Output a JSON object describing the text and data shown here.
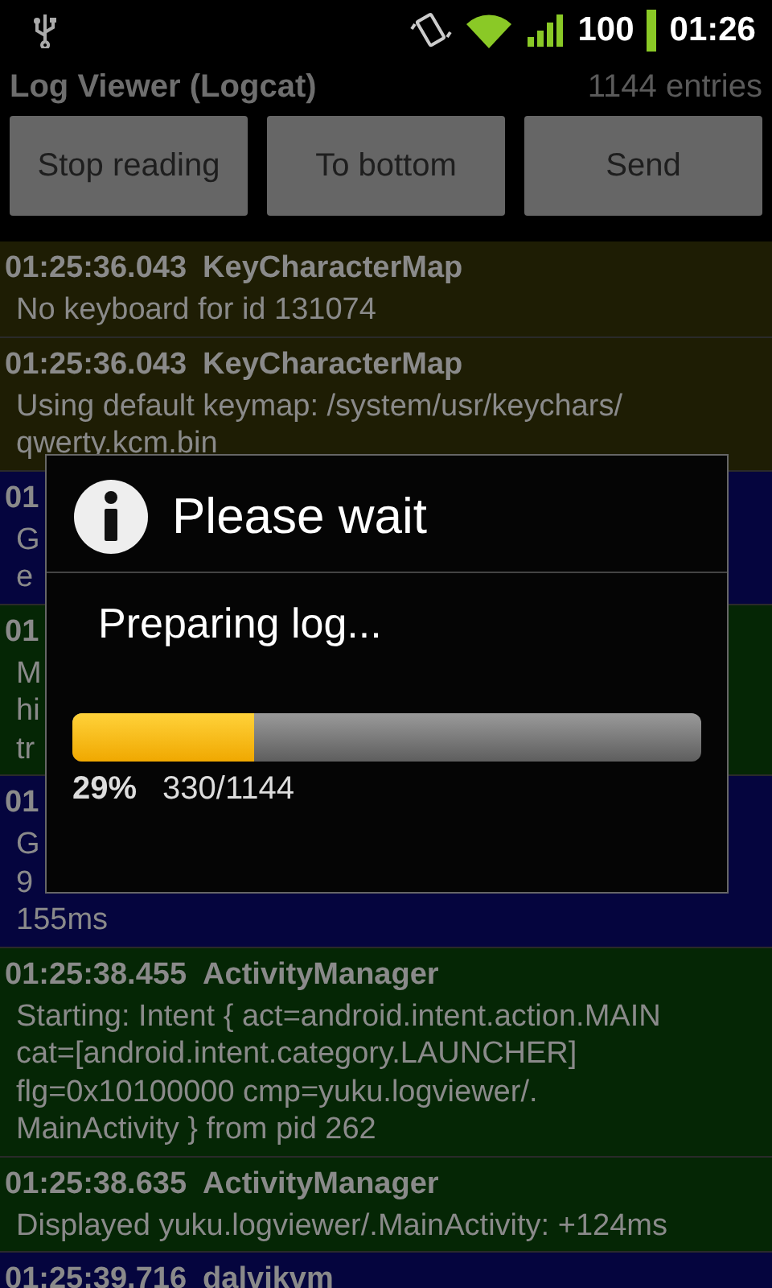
{
  "status_bar": {
    "battery": "100",
    "time": "01:26"
  },
  "header": {
    "title": "Log Viewer (Logcat)",
    "count": "1144 entries"
  },
  "buttons": [
    "Stop reading",
    "To bottom",
    "Send"
  ],
  "log_entries": [
    {
      "time": "01:25:36.043",
      "tag": "KeyCharacterMap",
      "message": "No keyboard for id 131074",
      "color": "#1e1d04"
    },
    {
      "time": "01:25:36.043",
      "tag": "KeyCharacterMap",
      "message": "Using default keymap: /system/usr/keychars/ qwerty.kcm.bin",
      "color": "#1e1d04"
    },
    {
      "time": "01",
      "lines": [
        "G",
        "e"
      ],
      "color": "#05053e"
    },
    {
      "time": "01",
      "lines": [
        "M",
        "hi",
        "tr"
      ],
      "color": "#052605"
    },
    {
      "time": "01",
      "lines": [
        "G",
        "9",
        "155ms"
      ],
      "color": "#05053e"
    },
    {
      "time": "01:25:38.455",
      "tag": "ActivityManager",
      "message": "Starting: Intent { act=android.intent.action.MAIN cat=[android.intent.category.LAUNCHER] flg=0x10100000 cmp=yuku.logviewer/. MainActivity } from pid 262",
      "color": "#052605"
    },
    {
      "time": "01:25:38.635",
      "tag": "ActivityManager",
      "message": "Displayed yuku.logviewer/.MainActivity: +124ms",
      "color": "#052605"
    },
    {
      "time": "01:25:39.716",
      "tag": "dalvikvm",
      "color": "#05053e"
    }
  ],
  "dialog": {
    "title": "Please wait",
    "message": "Preparing log...",
    "progress": {
      "level": 0.29,
      "percent": "29%",
      "count": "330/1144"
    }
  }
}
